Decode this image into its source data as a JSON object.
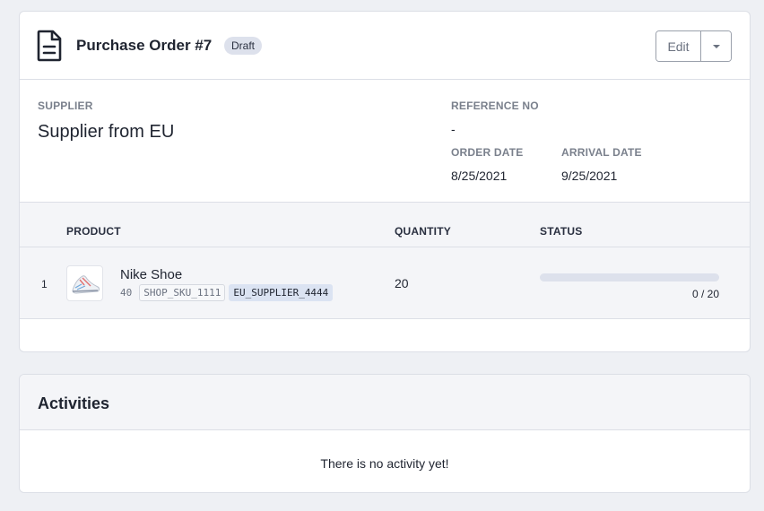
{
  "purchase_order": {
    "title": "Purchase Order #7",
    "status_badge": "Draft",
    "edit_label": "Edit",
    "supplier": {
      "label": "SUPPLIER",
      "value": "Supplier from EU"
    },
    "reference": {
      "label": "REFERENCE NO",
      "value": "-"
    },
    "order_date": {
      "label": "ORDER DATE",
      "value": "8/25/2021"
    },
    "arrival_date": {
      "label": "ARRIVAL DATE",
      "value": "9/25/2021"
    }
  },
  "table": {
    "columns": {
      "product": "PRODUCT",
      "quantity": "QUANTITY",
      "status": "STATUS"
    },
    "rows": [
      {
        "index": "1",
        "product_name": "Nike Shoe",
        "meta_number": "40",
        "shop_sku": "SHOP_SKU_1111",
        "supplier_sku": "EU_SUPPLIER_4444",
        "quantity": "20",
        "received_fraction": 0,
        "progress_text": "0 / 20"
      }
    ]
  },
  "activities": {
    "title": "Activities",
    "empty_text": "There is no activity yet!"
  },
  "colors": {
    "page_bg": "#eef0f4",
    "badge_bg": "#dde1ec",
    "progress_track": "#dde1ec",
    "supplier_sku_bg": "#dbe3f2"
  },
  "icons": {
    "header": "document-icon",
    "dropdown": "caret-down-icon",
    "product_thumb": "sneaker-image"
  }
}
